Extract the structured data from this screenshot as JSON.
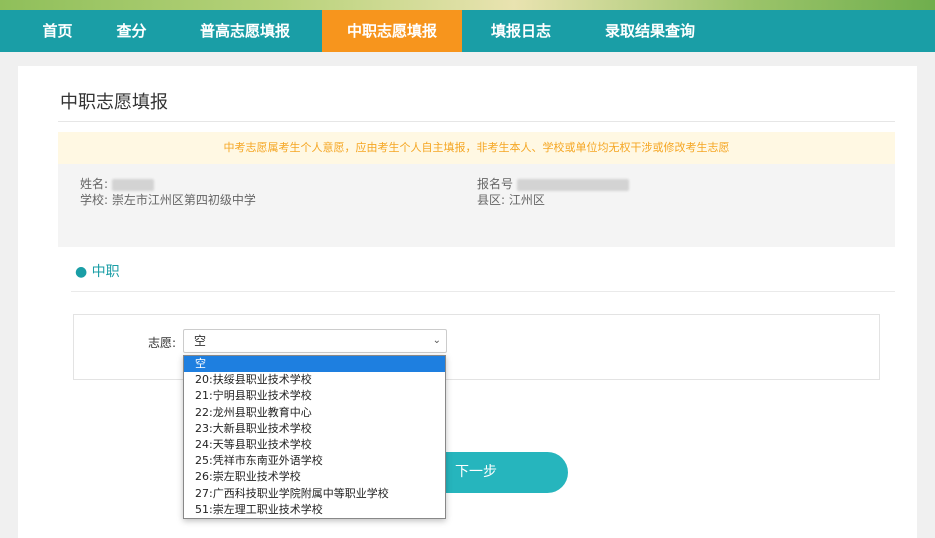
{
  "nav": {
    "items": [
      "首页",
      "查分",
      "普高志愿填报",
      "中职志愿填报",
      "填报日志",
      "录取结果查询"
    ],
    "active_index": 3,
    "colors": {
      "bar": "#1a9ea6",
      "active": "#f7951d"
    }
  },
  "page": {
    "title": "中职志愿填报",
    "notice": "中考志愿属考生个人意愿，应由考生个人自主填报，非考生本人、学校或单位均无权干涉或修改考生志愿"
  },
  "student": {
    "name_label": "姓名:",
    "school_label": "学校:",
    "school_value": "崇左市江州区第四初级中学",
    "reg_label": "报名号",
    "county_label": "县区:",
    "county_value": "江州区"
  },
  "section": {
    "title": "中职",
    "choice_label": "志愿:",
    "selected_value": "空"
  },
  "dropdown": {
    "options": [
      "空",
      "20:扶绥县职业技术学校",
      "21:宁明县职业技术学校",
      "22:龙州县职业教育中心",
      "23:大新县职业技术学校",
      "24:天等县职业技术学校",
      "25:凭祥市东南亚外语学校",
      "26:崇左职业技术学校",
      "27:广西科技职业学院附属中等职业学校",
      "51:崇左理工职业技术学校"
    ],
    "highlight_index": 0
  },
  "buttons": {
    "next": "下一步"
  }
}
